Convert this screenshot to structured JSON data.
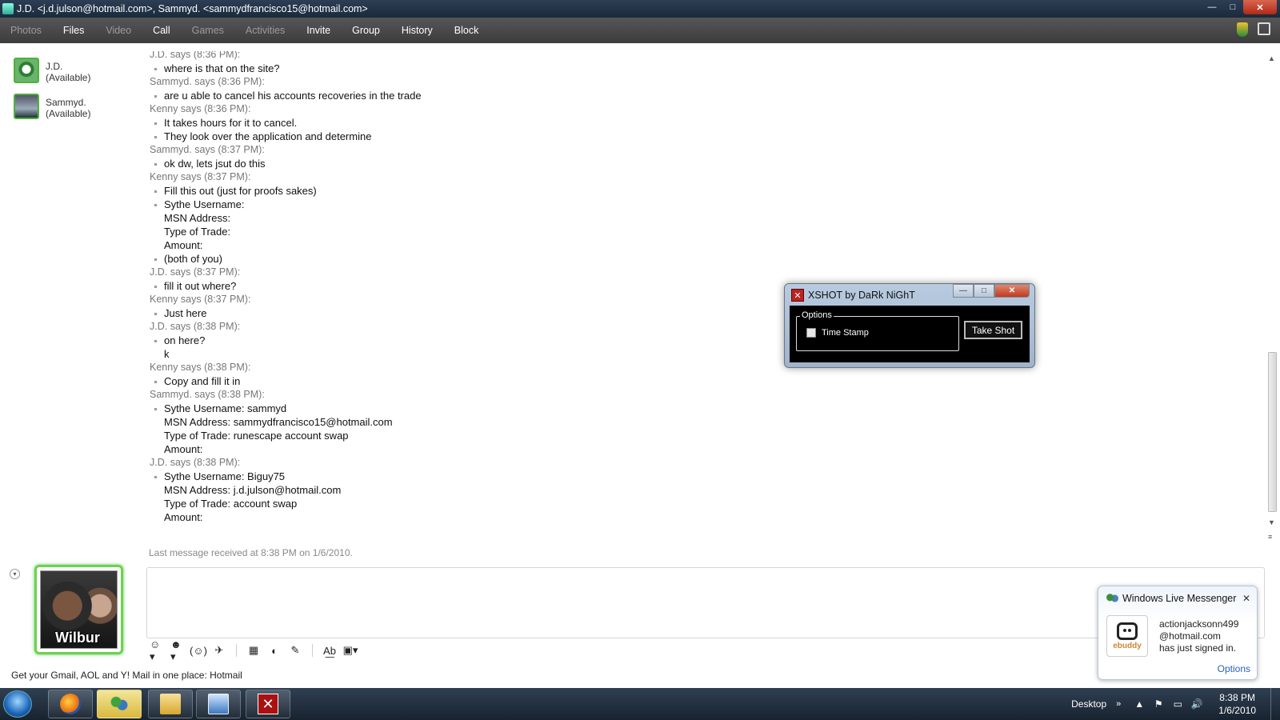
{
  "window": {
    "title": "J.D. <j.d.julson@hotmail.com>, Sammyd. <sammydfrancisco15@hotmail.com>",
    "controls": {
      "minimize": "—",
      "maximize": "□",
      "close": "✕"
    }
  },
  "menu": {
    "items": [
      {
        "label": "Photos",
        "enabled": false
      },
      {
        "label": "Files",
        "enabled": true
      },
      {
        "label": "Video",
        "enabled": false
      },
      {
        "label": "Call",
        "enabled": true
      },
      {
        "label": "Games",
        "enabled": false
      },
      {
        "label": "Activities",
        "enabled": false
      },
      {
        "label": "Invite",
        "enabled": true
      },
      {
        "label": "Group",
        "enabled": true
      },
      {
        "label": "History",
        "enabled": true
      },
      {
        "label": "Block",
        "enabled": true
      }
    ]
  },
  "contacts": [
    {
      "name": "J.D.",
      "status": "(Available)"
    },
    {
      "name": "Sammyd.",
      "status": "(Available)"
    }
  ],
  "conversation": [
    {
      "sender": "J.D. says (8:36 PM):",
      "lines": [
        "where is that on the site?"
      ],
      "bulleted": [
        true
      ]
    },
    {
      "sender": "Sammyd. says (8:36 PM):",
      "lines": [
        "are u able to cancel his accounts recoveries in the trade"
      ],
      "bulleted": [
        true
      ]
    },
    {
      "sender": "Kenny says (8:36 PM):",
      "lines": [
        "It takes hours for it to cancel.",
        "They look over the application and determine"
      ],
      "bulleted": [
        true,
        true
      ]
    },
    {
      "sender": "Sammyd. says (8:37 PM):",
      "lines": [
        "ok dw, lets jsut do this"
      ],
      "bulleted": [
        true
      ]
    },
    {
      "sender": "Kenny says (8:37 PM):",
      "lines": [
        "Fill this out (just for proofs sakes)",
        "Sythe Username:",
        "MSN Address:",
        "Type of Trade:",
        "Amount:",
        "(both of you)"
      ],
      "bulleted": [
        true,
        true,
        false,
        false,
        false,
        true
      ]
    },
    {
      "sender": "J.D. says (8:37 PM):",
      "lines": [
        "fill it out where?"
      ],
      "bulleted": [
        true
      ]
    },
    {
      "sender": "Kenny says (8:37 PM):",
      "lines": [
        "Just here"
      ],
      "bulleted": [
        true
      ]
    },
    {
      "sender": "J.D. says (8:38 PM):",
      "lines": [
        "on here?",
        "k"
      ],
      "bulleted": [
        true,
        false
      ]
    },
    {
      "sender": "Kenny says (8:38 PM):",
      "lines": [
        "Copy and fill it in"
      ],
      "bulleted": [
        true
      ]
    },
    {
      "sender": "Sammyd. says (8:38 PM):",
      "lines": [
        "Sythe Username: sammyd",
        "MSN Address: sammydfrancisco15@hotmail.com",
        "Type of Trade:  runescape account swap",
        "Amount:"
      ],
      "bulleted": [
        true,
        false,
        false,
        false
      ]
    },
    {
      "sender": "J.D. says (8:38 PM):",
      "lines": [
        "Sythe Username: Biguy75",
        "MSN Address: j.d.julson@hotmail.com",
        "Type of Trade: account swap",
        "Amount:"
      ],
      "bulleted": [
        true,
        false,
        false,
        false
      ]
    }
  ],
  "last_message": "Last message received at 8:38 PM on 1/6/2010.",
  "own_avatar_caption": "Wilbur",
  "compose_toolbar": {
    "icons": [
      "emoticon-icon",
      "wink-icon",
      "nudge-icon",
      "voice-clip-icon",
      "background-icon",
      "ink-icon",
      "handwriting-icon",
      "font-icon",
      "snapshot-icon"
    ],
    "glyphs": [
      "☺▾",
      "☻▾",
      "(☺)",
      "✈",
      "▦",
      "◐",
      "✎",
      "A͟b",
      "▣▾"
    ]
  },
  "ad_text": "Get your Gmail, AOL and Y! Mail in one place: Hotmail",
  "xshot": {
    "title": "XSHOT by DaRk NiGhT",
    "icon_glyph": "✕",
    "options_label": "Options",
    "checkbox_label": "Time Stamp",
    "checkbox_checked": false,
    "button_label": "Take Shot"
  },
  "toast": {
    "title": "Windows Live Messenger",
    "close": "✕",
    "brand": "ebuddy",
    "message_lines": [
      "actionjacksonn499",
      "@hotmail.com",
      "has just signed in."
    ],
    "options_link": "Options"
  },
  "taskbar": {
    "desktop_label": "Desktop",
    "chevron": "»",
    "tray_glyphs": [
      "▲",
      "⚑",
      "▭",
      "🔊"
    ],
    "time": "8:38 PM",
    "date": "1/6/2010"
  }
}
